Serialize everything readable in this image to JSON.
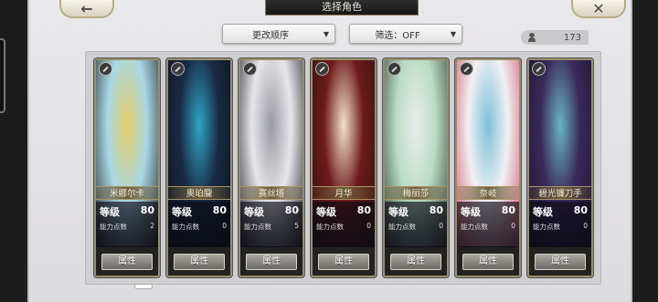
{
  "header": {
    "title": "选择角色",
    "back_icon": "←",
    "close_icon": "✕"
  },
  "controls": {
    "order_label": "更改顺序",
    "filter_label": "筛选：OFF",
    "dropdown_arrow": "▼",
    "count": "173"
  },
  "cards": [
    {
      "name": "米娜尔卡",
      "level_label": "等级",
      "level": "80",
      "points_label": "能力点数",
      "points": "2",
      "button": "属性",
      "colors": [
        "#a8d8e6",
        "#e8d16a",
        "#2a2a2a"
      ]
    },
    {
      "name": "奥珀朧",
      "level_label": "等级",
      "level": "80",
      "points_label": "能力点数",
      "points": "0",
      "button": "属性",
      "colors": [
        "#1a2a44",
        "#2fa4c4",
        "#0b1220"
      ]
    },
    {
      "name": "赛丝塔",
      "level_label": "等级",
      "level": "80",
      "points_label": "能力点数",
      "points": "5",
      "button": "属性",
      "colors": [
        "#e6e6ea",
        "#9a9aa6",
        "#2a2a34"
      ]
    },
    {
      "name": "月华",
      "level_label": "等级",
      "level": "80",
      "points_label": "能力点数",
      "points": "0",
      "button": "属性",
      "colors": [
        "#6e1a1a",
        "#f2e2c8",
        "#2a1414"
      ]
    },
    {
      "name": "梅丽莎",
      "level_label": "等级",
      "level": "80",
      "points_label": "能力点数",
      "points": "0",
      "button": "属性",
      "colors": [
        "#b8dcc4",
        "#ececec",
        "#3a4a3e"
      ]
    },
    {
      "name": "奈岐",
      "level_label": "等级",
      "level": "80",
      "points_label": "能力点数",
      "points": "0",
      "button": "属性",
      "colors": [
        "#f0f0f4",
        "#7ec0d8",
        "#d65a6a"
      ]
    },
    {
      "name": "碧光镰刀手",
      "level_label": "等级",
      "level": "80",
      "points_label": "能力点数",
      "points": "0",
      "button": "属性",
      "colors": [
        "#3a2a5a",
        "#6ab4c4",
        "#1a1430"
      ]
    }
  ]
}
